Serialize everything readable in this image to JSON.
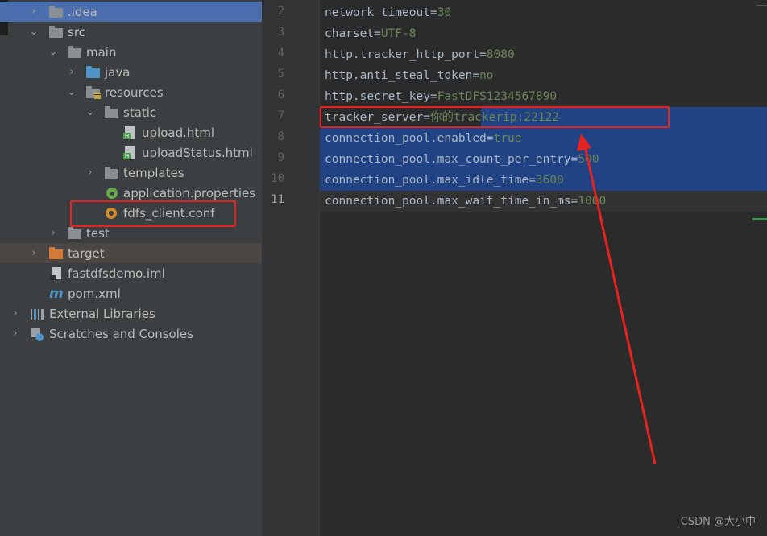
{
  "project_tree": {
    "items": [
      {
        "label": ".idea",
        "icon": "folder-icon",
        "expanded": false,
        "selected": true
      },
      {
        "label": "src",
        "icon": "folder-icon",
        "expanded": true
      },
      {
        "label": "main",
        "icon": "folder-icon",
        "expanded": true
      },
      {
        "label": "java",
        "icon": "source-folder-icon",
        "expanded": false
      },
      {
        "label": "resources",
        "icon": "resources-folder-icon",
        "expanded": true
      },
      {
        "label": "static",
        "icon": "folder-icon",
        "expanded": true
      },
      {
        "label": "upload.html",
        "icon": "html-file-icon"
      },
      {
        "label": "uploadStatus.html",
        "icon": "html-file-icon"
      },
      {
        "label": "templates",
        "icon": "folder-icon",
        "expanded": false
      },
      {
        "label": "application.properties",
        "icon": "spring-properties-icon"
      },
      {
        "label": "fdfs_client.conf",
        "icon": "config-file-icon"
      },
      {
        "label": "test",
        "icon": "folder-icon",
        "expanded": false
      },
      {
        "label": "target",
        "icon": "excluded-folder-icon",
        "expanded": false
      },
      {
        "label": "fastdfsdemo.iml",
        "icon": "module-file-icon"
      },
      {
        "label": "pom.xml",
        "icon": "maven-icon"
      },
      {
        "label": "External Libraries",
        "icon": "library-icon",
        "expanded": false
      },
      {
        "label": "Scratches and Consoles",
        "icon": "scratches-icon",
        "expanded": false
      }
    ]
  },
  "editor": {
    "lines": [
      {
        "num": "2",
        "key": "network_timeout",
        "value": "30"
      },
      {
        "num": "3",
        "key": "charset",
        "value": "UTF-8"
      },
      {
        "num": "4",
        "key": "http.tracker_http_port",
        "value": "8080"
      },
      {
        "num": "5",
        "key": "http.anti_steal_token",
        "value": "no"
      },
      {
        "num": "6",
        "key": "http.secret_key",
        "value": "FastDFS1234567890"
      },
      {
        "num": "7",
        "key": "tracker_server",
        "value": "你的trackerip:22122"
      },
      {
        "num": "8",
        "key": "connection_pool.enabled",
        "value": "true"
      },
      {
        "num": "9",
        "key": "connection_pool.max_count_per_entry",
        "value": "500"
      },
      {
        "num": "10",
        "key": "connection_pool.max_idle_time",
        "value": "3600"
      },
      {
        "num": "11",
        "key": "connection_pool.max_wait_time_in_ms",
        "value": "1000"
      }
    ]
  },
  "watermark": "CSDN @大小中",
  "colors": {
    "annotation": "#e8231f",
    "selection": "#214283",
    "tree_selection": "#4b6eaf"
  }
}
